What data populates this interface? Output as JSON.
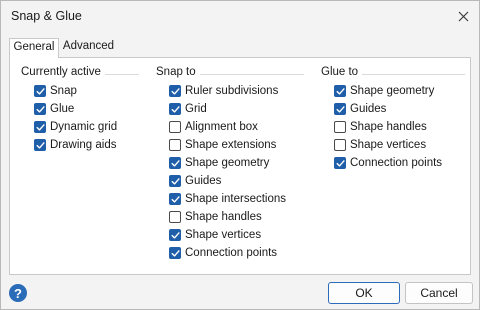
{
  "window": {
    "title": "Snap & Glue"
  },
  "tabs": [
    {
      "label": "General",
      "active": true
    },
    {
      "label": "Advanced",
      "active": false
    }
  ],
  "groups": {
    "currently_active": {
      "title": "Currently active",
      "items": [
        {
          "label": "Snap",
          "checked": true
        },
        {
          "label": "Glue",
          "checked": true
        },
        {
          "label": "Dynamic grid",
          "checked": true
        },
        {
          "label": "Drawing aids",
          "checked": true
        }
      ]
    },
    "snap_to": {
      "title": "Snap to",
      "items": [
        {
          "label": "Ruler subdivisions",
          "checked": true
        },
        {
          "label": "Grid",
          "checked": true
        },
        {
          "label": "Alignment box",
          "checked": false
        },
        {
          "label": "Shape extensions",
          "checked": false
        },
        {
          "label": "Shape geometry",
          "checked": true
        },
        {
          "label": "Guides",
          "checked": true
        },
        {
          "label": "Shape intersections",
          "checked": true
        },
        {
          "label": "Shape handles",
          "checked": false
        },
        {
          "label": "Shape vertices",
          "checked": true
        },
        {
          "label": "Connection points",
          "checked": true
        }
      ]
    },
    "glue_to": {
      "title": "Glue to",
      "items": [
        {
          "label": "Shape geometry",
          "checked": true
        },
        {
          "label": "Guides",
          "checked": true
        },
        {
          "label": "Shape handles",
          "checked": false
        },
        {
          "label": "Shape vertices",
          "checked": false
        },
        {
          "label": "Connection points",
          "checked": true
        }
      ]
    }
  },
  "buttons": {
    "ok": "OK",
    "cancel": "Cancel"
  },
  "help": {
    "glyph": "?"
  },
  "colors": {
    "accent": "#1f5ea8",
    "help": "#2b6cb8"
  }
}
